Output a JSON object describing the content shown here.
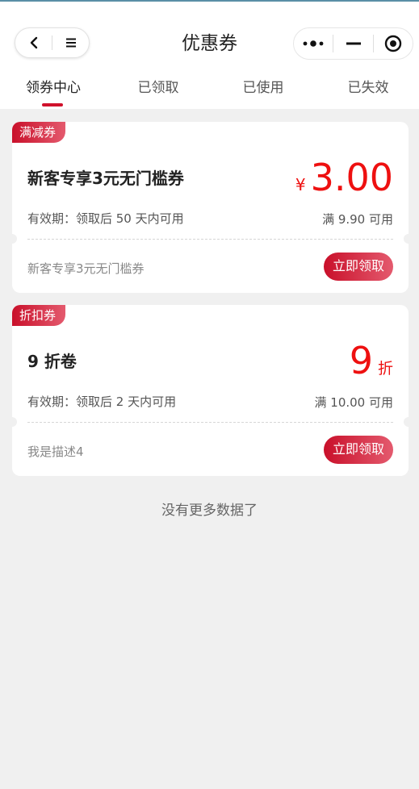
{
  "header": {
    "title": "优惠券",
    "nav_icons": [
      "back-chevron-icon",
      "menu-icon"
    ],
    "capsule_icons": [
      "more-dots-icon",
      "minimize-icon",
      "close-target-icon"
    ]
  },
  "tabs": [
    {
      "label": "领券中心",
      "active": true
    },
    {
      "label": "已领取",
      "active": false
    },
    {
      "label": "已使用",
      "active": false
    },
    {
      "label": "已失效",
      "active": false
    }
  ],
  "coupons": [
    {
      "badge": "满减券",
      "title": "新客专享3元无门槛券",
      "currency": "¥",
      "amount": "3.00",
      "unit": "",
      "validity": "有效期：领取后 50 天内可用",
      "condition": "满 9.90 可用",
      "description": "新客专享3元无门槛券",
      "button": "立即领取"
    },
    {
      "badge": "折扣券",
      "title": "9 折卷",
      "currency": "",
      "amount": "9",
      "unit": "折",
      "validity": "有效期：领取后 2 天内可用",
      "condition": "满 10.00 可用",
      "description": "我是描述4",
      "button": "立即领取"
    }
  ],
  "footer": {
    "no_more": "没有更多数据了"
  },
  "colors": {
    "accent": "#d0112b",
    "price": "#ee1010",
    "background": "#f0f0f0"
  }
}
